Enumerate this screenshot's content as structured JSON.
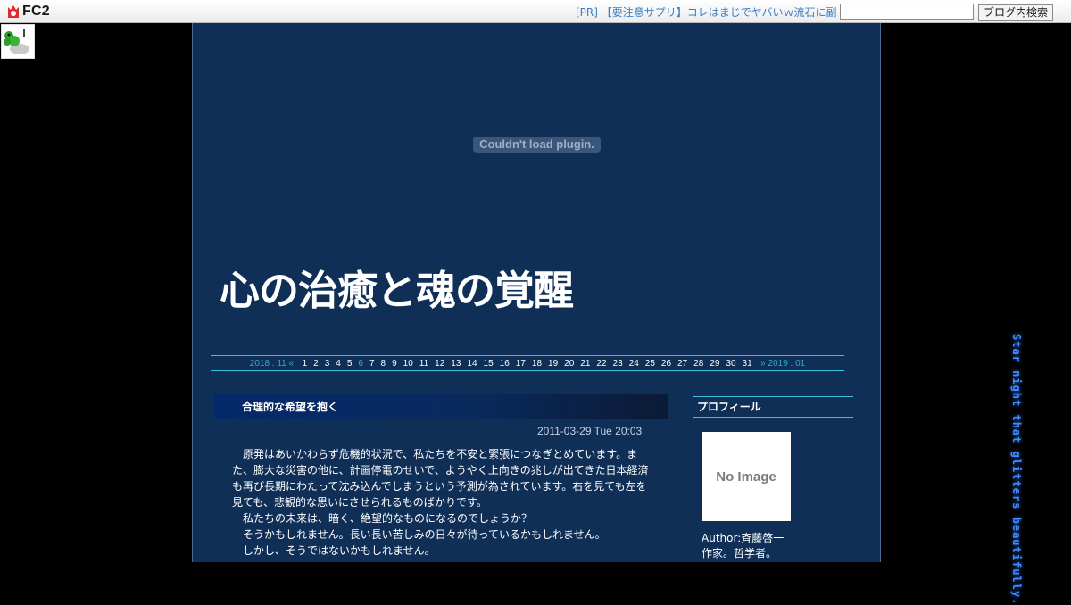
{
  "topbar": {
    "logo_text": "FC2",
    "pr_link": "[PR] 【要注意サプリ】コレはまじでヤバいｗ流石に副",
    "search_placeholder": "",
    "search_button": "ブログ内検索"
  },
  "plugin_message": "Couldn't load plugin.",
  "blog": {
    "title": "心の治癒と魂の覚醒"
  },
  "calendar": {
    "prev": "2018 . 11 «",
    "days": [
      "1",
      "2",
      "3",
      "4",
      "5",
      "6",
      "7",
      "8",
      "9",
      "10",
      "11",
      "12",
      "13",
      "14",
      "15",
      "16",
      "17",
      "18",
      "19",
      "20",
      "21",
      "22",
      "23",
      "24",
      "25",
      "26",
      "27",
      "28",
      "29",
      "30",
      "31"
    ],
    "today_index": 5,
    "next": "» 2019 . 01"
  },
  "entry": {
    "title": "合理的な希望を抱く",
    "date": "2011-03-29 Tue 20:03",
    "paragraphs": [
      "　原発はあいかわらず危機的状況で、私たちを不安と緊張につなぎとめています。また、膨大な災害の他に、計画停電のせいで、ようやく上向きの兆しが出てきた日本経済も再び長期にわたって沈み込んでしまうという予測が為されています。右を見ても左を見ても、悲観的な思いにさせられるものばかりです。",
      "　私たちの未来は、暗く、絶望的なものになるのでしょうか？",
      "　そうかもしれません。長い長い苦しみの日々が待っているかもしれません。",
      "　しかし、そうではないかもしれません。"
    ]
  },
  "sidebar": {
    "profile_heading": "プロフィール",
    "noimage_text": "No Image",
    "author_line": "Author:斉藤啓一",
    "bio_line": "作家。哲学者。"
  },
  "decor_text": "Star night that glitters beautifully."
}
